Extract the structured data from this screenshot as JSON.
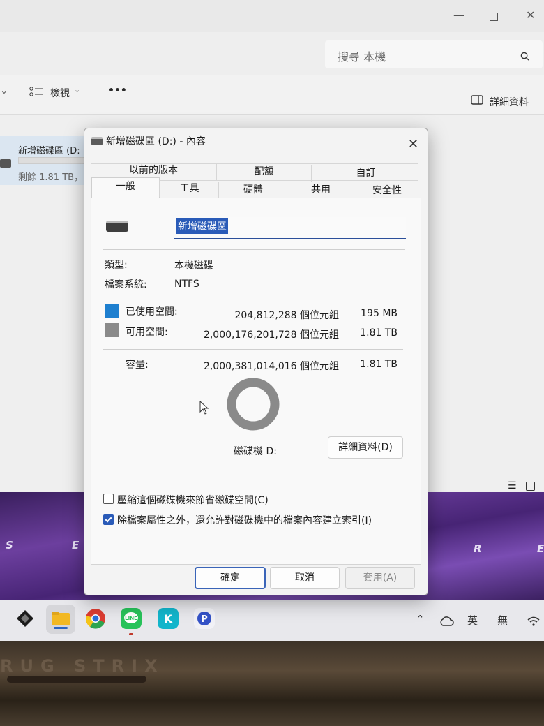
{
  "explorer": {
    "search_placeholder": "搜尋 本機",
    "toolbar": {
      "view_label": "檢視",
      "details_label": "詳細資料",
      "more_label": "•••"
    },
    "drive_entry": {
      "name": "新增磁碟區 (D:",
      "free": "剩餘 1.81 TB，"
    }
  },
  "wallpaper_letters": [
    "S",
    "E",
    "R",
    "E"
  ],
  "brand": "RUG STRIX",
  "dialog": {
    "title": "新增磁碟區 (D:) - 內容",
    "tabs_back": [
      "以前的版本",
      "配額",
      "自訂"
    ],
    "tabs_front": [
      "一般",
      "工具",
      "硬體",
      "共用",
      "安全性"
    ],
    "active_tab": "一般",
    "volume_name": "新增磁碟區",
    "type_label": "類型:",
    "type_value": "本機磁碟",
    "fs_label": "檔案系統:",
    "fs_value": "NTFS",
    "used": {
      "label": "已使用空間:",
      "bytes": "204,812,288 個位元組",
      "size": "195 MB",
      "color": "#1e7fcf"
    },
    "free": {
      "label": "可用空間:",
      "bytes": "2,000,176,201,728 個位元組",
      "size": "1.81 TB",
      "color": "#8a8a8a"
    },
    "capacity": {
      "label": "容量:",
      "bytes": "2,000,381,014,016 個位元組",
      "size": "1.81 TB"
    },
    "used_fraction": 0.0001,
    "drive_label": "磁碟機 D:",
    "details_button": "詳細資料(D)",
    "compress_label": "壓縮這個磁碟機來節省磁碟空間(C)",
    "compress_checked": false,
    "index_label": "除檔案屬性之外，還允許對磁碟機中的檔案內容建立索引(I)",
    "index_checked": true,
    "ok_button": "確定",
    "cancel_button": "取消",
    "apply_button": "套用(A)"
  },
  "tray": {
    "ime1": "英",
    "ime2": "無"
  }
}
